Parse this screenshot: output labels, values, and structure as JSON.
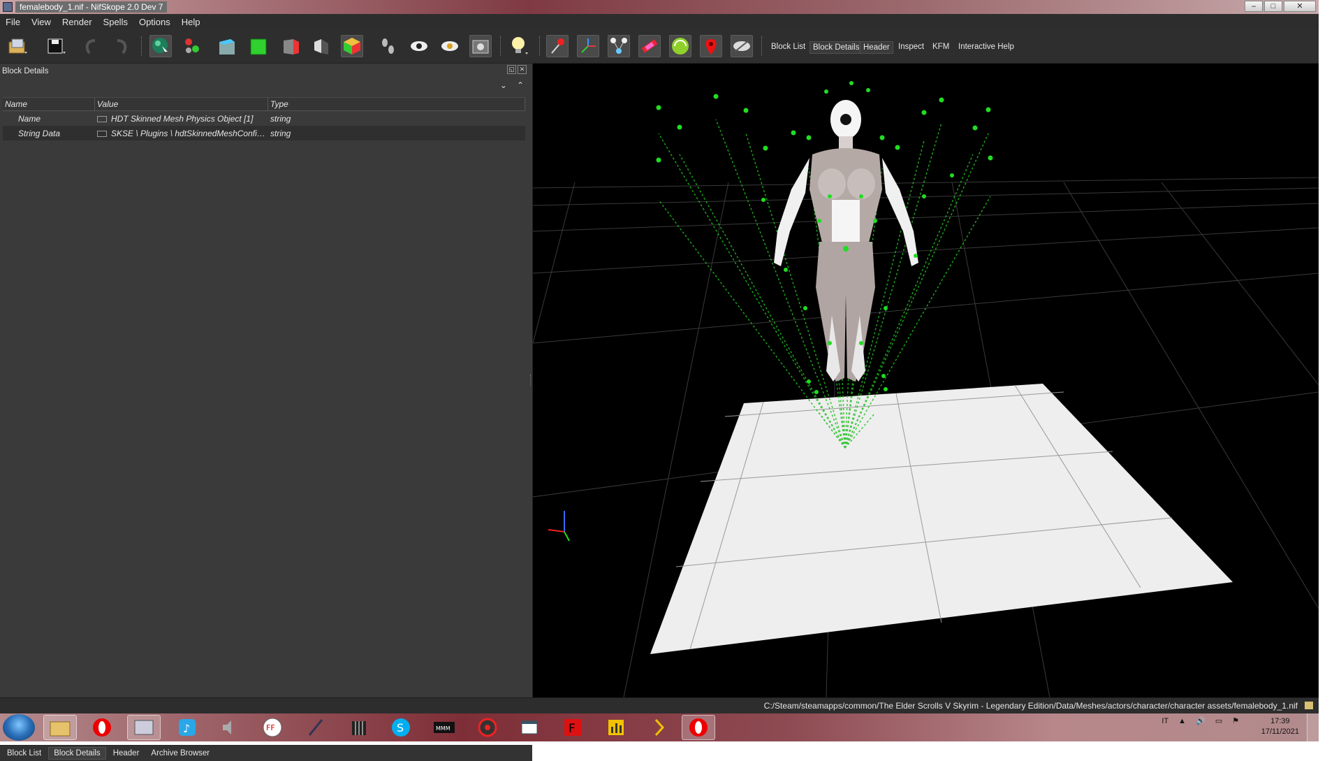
{
  "window": {
    "title": "femalebody_1.nif - NifSkope 2.0 Dev 7",
    "controls": {
      "minimize": "–",
      "maximize": "□",
      "close": "✕"
    }
  },
  "menu": {
    "items": [
      "File",
      "View",
      "Render",
      "Spells",
      "Options",
      "Help"
    ]
  },
  "toolbar": {
    "icons": [
      "load-icon",
      "save-icon",
      "undo-icon",
      "redo-icon",
      "select-mode-icon",
      "weight-paint-icon",
      "view-top-icon",
      "view-front-icon",
      "view-side-icon",
      "view-walk-icon",
      "view-user-icon",
      "footprints-icon",
      "eye-icon",
      "eye-texture-icon",
      "screenshot-icon",
      "light-bulb-icon",
      "pin-icon",
      "axes-icon",
      "nodes-icon",
      "havok-icon",
      "constraint-icon",
      "marker-icon",
      "hide-icon"
    ],
    "links": {
      "block_list": "Block List",
      "block_details": "Block Details",
      "header": "Header",
      "inspect": "Inspect",
      "kfm": "KFM",
      "interactive_help": "Interactive Help"
    }
  },
  "left_panel": {
    "title": "Block Details",
    "columns": [
      "Name",
      "Value",
      "Type"
    ],
    "rows": [
      {
        "name": "Name",
        "value": "HDT Skinned Mesh Physics Object [1]",
        "type": "string"
      },
      {
        "name": "String Data",
        "value": "SKSE \\ Plugins \\ hdtSkinnedMeshConfi…",
        "type": "string"
      }
    ],
    "bottom_tabs": [
      "Block List",
      "Block Details",
      "Header",
      "Archive Browser"
    ]
  },
  "status": {
    "path": "C:/Steam/steamapps/common/The Elder Scrolls V Skyrim - Legendary Edition/Data/Meshes/actors/character/character assets/femalebody_1.nif"
  },
  "taskbar": {
    "apps": [
      "explorer",
      "opera",
      "media-center",
      "itunes",
      "speaker",
      "ffdec",
      "feather",
      "metronome",
      "skype",
      "mmm",
      "gear",
      "window",
      "f-app",
      "chart",
      "arrow",
      "opera-active"
    ],
    "tray": {
      "lang": "IT"
    },
    "clock": {
      "time": "17:39",
      "date": "17/11/2021"
    }
  },
  "colors": {
    "accent_green": "#22dd22",
    "panel_bg": "#3a3a3a",
    "viewport_bg": "#000000"
  }
}
